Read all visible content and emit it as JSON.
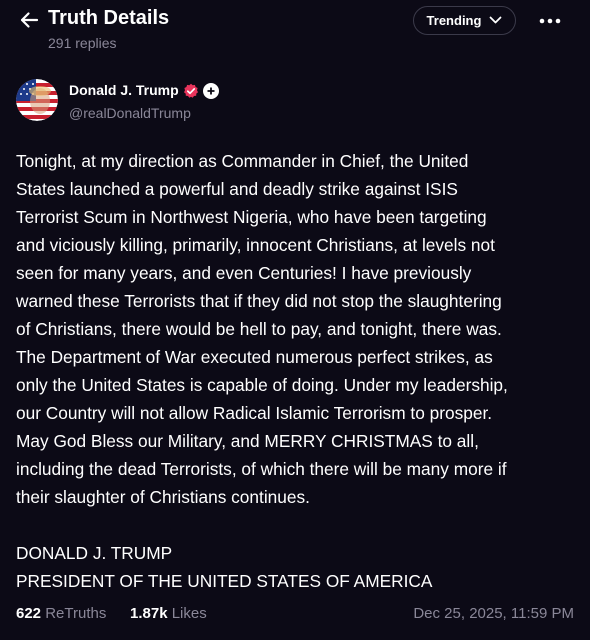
{
  "header": {
    "title": "Truth Details",
    "subtitle": "291 replies",
    "back_icon": "arrow-left-icon",
    "sort_label": "Trending",
    "sort_icon": "chevron-down-icon",
    "more_icon": "more-horizontal-icon"
  },
  "author": {
    "display_name": "Donald J. Trump",
    "handle": "@realDonaldTrump",
    "verified_icon": "verified-check-icon",
    "plus_icon": "plus-icon",
    "avatar_icon": "profile-avatar"
  },
  "post": {
    "lines": [
      "Tonight, at my direction as Commander in Chief, the United",
      "States launched a powerful and deadly strike against ISIS",
      "Terrorist Scum in Northwest Nigeria, who have been targeting",
      "and viciously killing, primarily, innocent Christians, at levels not",
      "seen for many years, and even Centuries! I have previously",
      "warned these Terrorists that if they did not stop the slaughtering",
      "of Christians, there would be hell to pay, and tonight, there was.",
      "The Department of War executed numerous perfect strikes, as",
      "only the United States is capable of doing. Under my leadership,",
      "our Country will not allow Radical Islamic Terrorism to prosper.",
      "May God Bless our Military, and MERRY CHRISTMAS to all,",
      "including the dead Terrorists, of which there will be many more if",
      "their slaughter of Christians continues."
    ],
    "signature": [
      "DONALD J. TRUMP",
      "PRESIDENT OF THE UNITED STATES OF AMERICA"
    ]
  },
  "stats": {
    "retruths_count": "622",
    "retruths_label": "ReTruths",
    "likes_count": "1.87k",
    "likes_label": "Likes",
    "timestamp": "Dec 25, 2025, 11:59 PM"
  },
  "colors": {
    "background": "#0c0a16",
    "text": "#ffffff",
    "muted": "#8a8798",
    "verified": "#e8345c"
  }
}
